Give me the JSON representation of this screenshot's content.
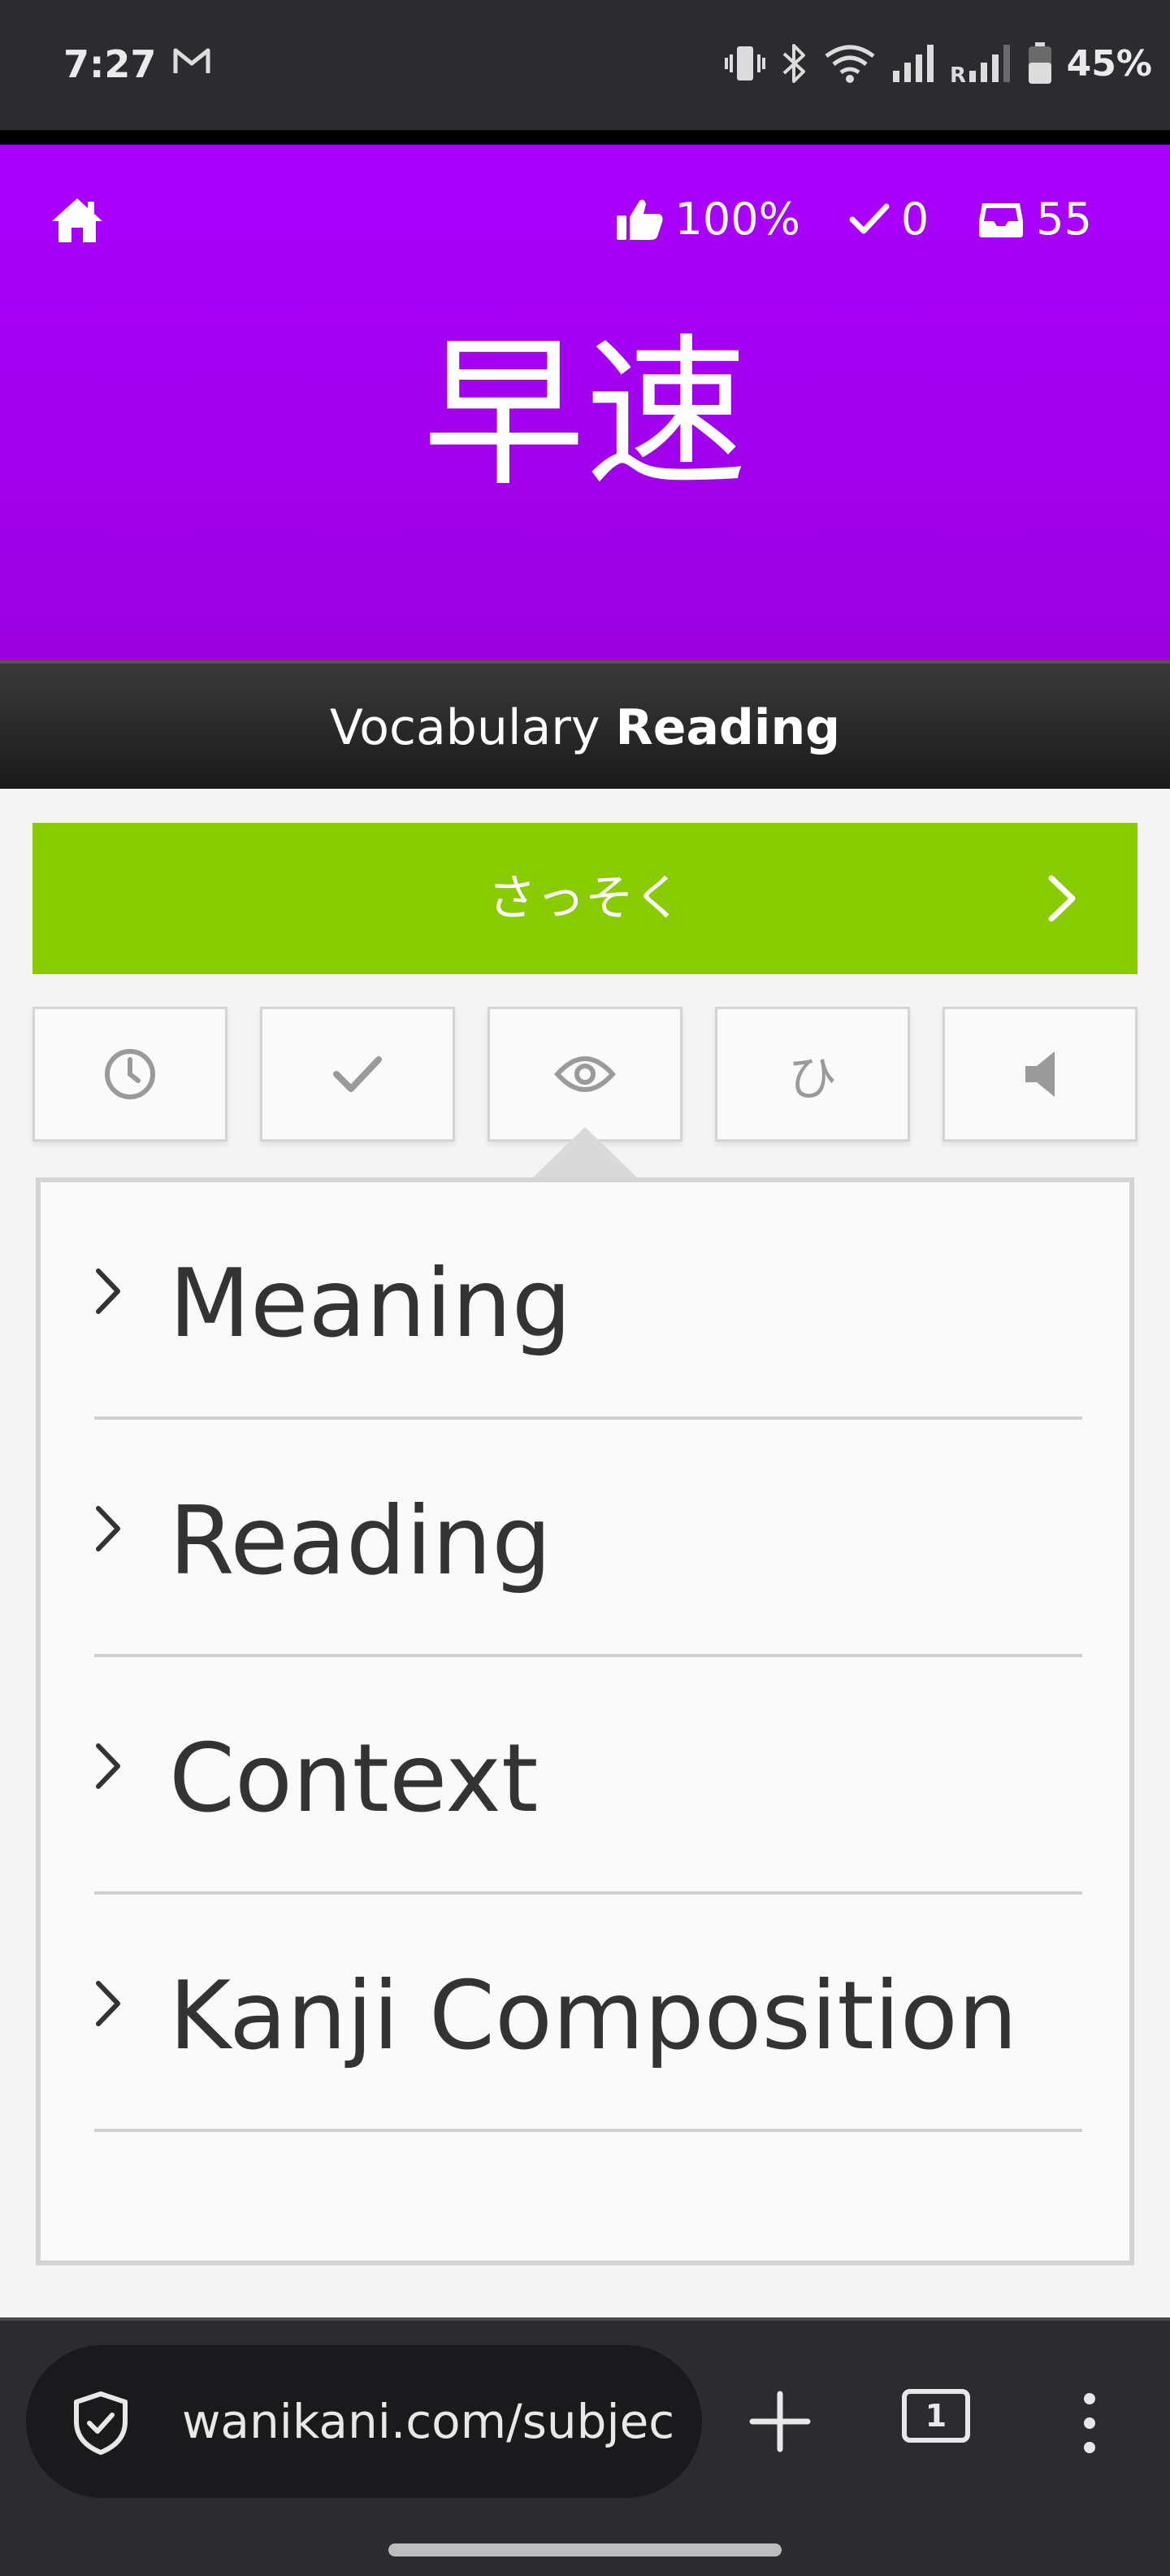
{
  "status_bar": {
    "time": "7:27",
    "battery": "45%",
    "icons": [
      "gmail-icon",
      "vibrate-icon",
      "bluetooth-icon",
      "wifi-icon",
      "signal-icon",
      "roaming-signal-icon",
      "battery-icon"
    ]
  },
  "header": {
    "color": "#aa00ff",
    "home_icon": "home-icon",
    "accuracy": "100%",
    "correct_count": "0",
    "remaining_count": "55",
    "subject_characters": "早速"
  },
  "category": {
    "type": "Vocabulary",
    "question": "Reading"
  },
  "answer": {
    "value": "さっそく",
    "color": "#88cc00"
  },
  "action_buttons": [
    {
      "name": "last-items-button",
      "icon": "clock-icon"
    },
    {
      "name": "mark-correct-button",
      "icon": "check-icon"
    },
    {
      "name": "item-info-button",
      "icon": "eye-icon"
    },
    {
      "name": "kana-chart-button",
      "label": "ひ"
    },
    {
      "name": "audio-button",
      "icon": "speaker-icon"
    }
  ],
  "info_sections": [
    {
      "label": "Meaning"
    },
    {
      "label": "Reading"
    },
    {
      "label": "Context"
    },
    {
      "label": "Kanji Composition"
    }
  ],
  "browser": {
    "url": "wanikani.com/subjec",
    "tab_count": "1"
  }
}
